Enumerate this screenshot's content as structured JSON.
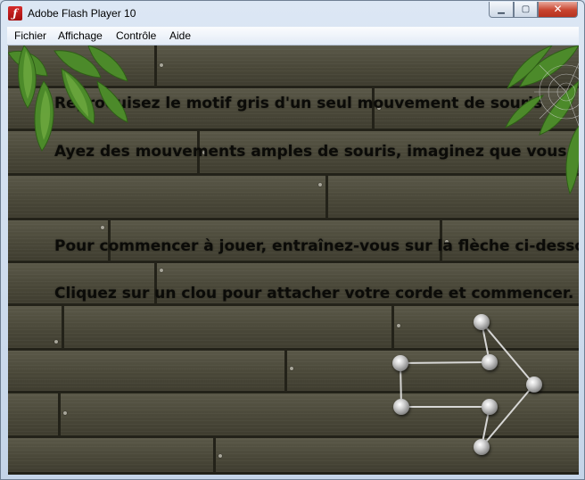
{
  "window": {
    "title": "Adobe Flash Player 10",
    "icon": "flash-player-icon",
    "icon_glyph": "ƒ",
    "buttons": {
      "minimize": "▁",
      "maximize": "▢",
      "close": "✕"
    }
  },
  "menu": {
    "items": [
      "Fichier",
      "Affichage",
      "Contrôle",
      "Aide"
    ]
  },
  "game": {
    "instructions": [
      "Reproduisez le motif gris d'un seul mouvement de souris",
      "Ayez des mouvements amples de souris, imaginez que vous t",
      "Pour commencer à jouer, entraînez-vous sur la flèche ci-dessou",
      "Cliquez sur un clou pour attacher votre corde et commencer. D"
    ],
    "pattern": "arrow",
    "nail_count": 7,
    "colors": {
      "wood": "#4c4a3c",
      "text": "#0b0b08",
      "rope": "#e6e6e6",
      "leaves": "#4c8a2a"
    }
  }
}
